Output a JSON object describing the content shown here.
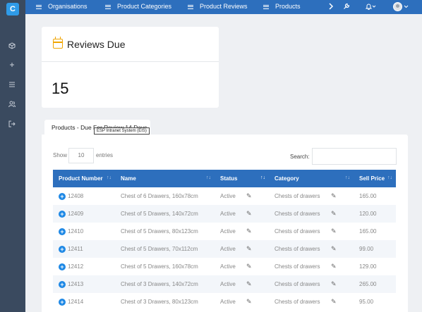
{
  "brand": {
    "logo_letter": "C"
  },
  "sidebar": {
    "icons": [
      "cube-icon",
      "plus-icon",
      "list-icon",
      "users-icon",
      "sign-out-icon"
    ]
  },
  "topnav": {
    "items": [
      "Organisations",
      "Product Categories",
      "Product Reviews",
      "Products"
    ]
  },
  "reviews_due": {
    "title": "Reviews Due",
    "count": "15"
  },
  "products_tab": {
    "label": "Products - Due For Review 14 Days",
    "tooltip": "ESP Intranet System (EIS)"
  },
  "table_controls": {
    "show_label": "Show",
    "page_length": "10",
    "entries_label": "entries",
    "search_label": "Search:"
  },
  "table": {
    "columns": [
      "Product Number",
      "Name",
      "Status",
      "Category",
      "Sell Price"
    ],
    "rows": [
      {
        "number": "12408",
        "name": "Chest of 6 Drawers, 160x78cm",
        "status": "Active",
        "category": "Chests of drawers",
        "price": "165.00"
      },
      {
        "number": "12409",
        "name": "Chest of 5 Drawers, 140x72cm",
        "status": "Active",
        "category": "Chests of drawers",
        "price": "120.00"
      },
      {
        "number": "12410",
        "name": "Chest of 5 Drawers, 80x123cm",
        "status": "Active",
        "category": "Chests of drawers",
        "price": "165.00"
      },
      {
        "number": "12411",
        "name": "Chest of 5 Drawers, 70x112cm",
        "status": "Active",
        "category": "Chests of drawers",
        "price": "99.00"
      },
      {
        "number": "12412",
        "name": "Chest of 5 Drawers, 160x78cm",
        "status": "Active",
        "category": "Chests of drawers",
        "price": "129.00"
      },
      {
        "number": "12413",
        "name": "Chest of 3 Drawers, 140x72cm",
        "status": "Active",
        "category": "Chests of drawers",
        "price": "265.00"
      },
      {
        "number": "12414",
        "name": "Chest of 3 Drawers, 80x123cm",
        "status": "Active",
        "category": "Chests of drawers",
        "price": "95.00"
      }
    ]
  },
  "colors": {
    "sidebar": "#3a4a5f",
    "topbar": "#2d6fbd",
    "table_header": "#2d6fbd",
    "accent_icon": "#f0a500",
    "expand_button": "#1e88e5"
  }
}
